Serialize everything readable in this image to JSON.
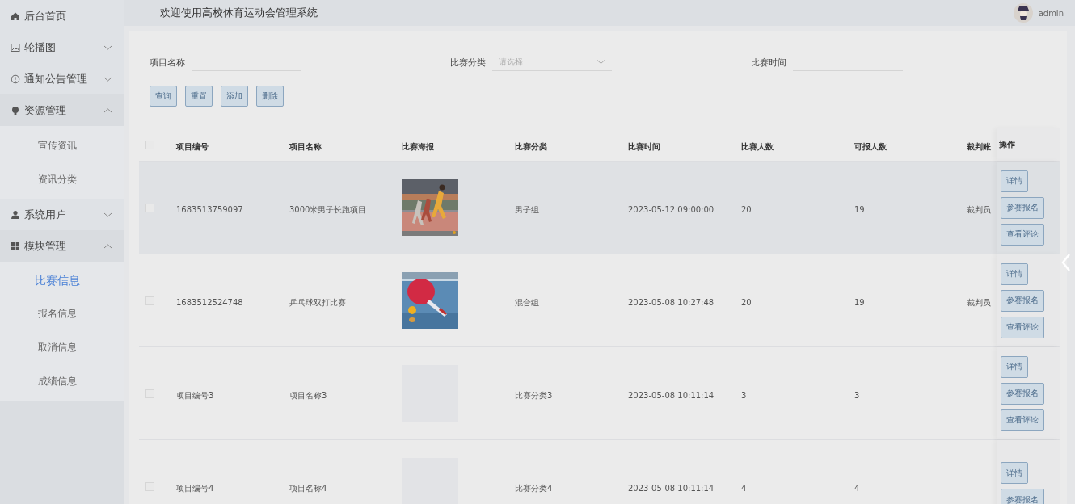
{
  "header": {
    "title": "欢迎使用高校体育运动会管理系统",
    "user": "admin"
  },
  "sidebar": {
    "items": [
      {
        "label": "后台首页"
      },
      {
        "label": "轮播图",
        "expanded": false
      },
      {
        "label": "通知公告管理",
        "expanded": false
      },
      {
        "label": "资源管理",
        "expanded": true,
        "children": [
          {
            "label": "宣传资讯",
            "selected": false
          },
          {
            "label": "资讯分类",
            "selected": false
          }
        ]
      },
      {
        "label": "系统用户",
        "expanded": false
      },
      {
        "label": "模块管理",
        "expanded": true,
        "children": [
          {
            "label": "比赛信息",
            "selected": true
          },
          {
            "label": "报名信息",
            "selected": false
          },
          {
            "label": "取消信息",
            "selected": false
          },
          {
            "label": "成绩信息",
            "selected": false
          }
        ]
      }
    ]
  },
  "search": {
    "fields": [
      {
        "kind": "input",
        "label": "项目名称"
      },
      {
        "kind": "select",
        "label": "比赛分类",
        "placeholder": "请选择"
      },
      {
        "kind": "input",
        "label": "比赛时间"
      }
    ],
    "buttons": [
      "查询",
      "重置",
      "添加",
      "删除"
    ]
  },
  "table": {
    "select_all": {
      "checked": false
    },
    "columns": [
      "项目编号",
      "项目名称",
      "比赛海报",
      "比赛分类",
      "比赛时间",
      "比赛人数",
      "可报人数",
      "裁判账",
      "操作"
    ],
    "rows": [
      {
        "checked": false,
        "highlighted": true,
        "cells": [
          "1683513759097",
          "3000米男子长跑项目",
          null,
          "男子组",
          "2023-05-12 09:00:00",
          "20",
          "19",
          "裁判员"
        ],
        "poster": {
          "kind": "picture"
        },
        "actions": [
          "详情",
          "参赛报名",
          "查看评论"
        ]
      },
      {
        "checked": false,
        "highlighted": false,
        "cells": [
          "1683512524748",
          "乒乓球双打比赛",
          null,
          "混合组",
          "2023-05-08 10:27:48",
          "20",
          "19",
          "裁判员"
        ],
        "poster": {
          "kind": "picture"
        },
        "actions": [
          "详情",
          "参赛报名",
          "查看评论"
        ]
      },
      {
        "checked": false,
        "highlighted": false,
        "cells": [
          "项目编号3",
          "项目名称3",
          null,
          "比赛分类3",
          "2023-05-08 10:11:14",
          "3",
          "3"
        ],
        "poster": {
          "kind": "empty"
        },
        "actions": [
          "详情",
          "参赛报名",
          "查看评论"
        ]
      },
      {
        "checked": false,
        "highlighted": false,
        "cells": [
          "项目编号4",
          "项目名称4",
          null,
          "比赛分类4",
          "2023-05-08 10:11:14",
          "4",
          "4"
        ],
        "poster": {
          "kind": "empty"
        },
        "actions": [
          "详情",
          "参赛报名"
        ]
      }
    ]
  }
}
